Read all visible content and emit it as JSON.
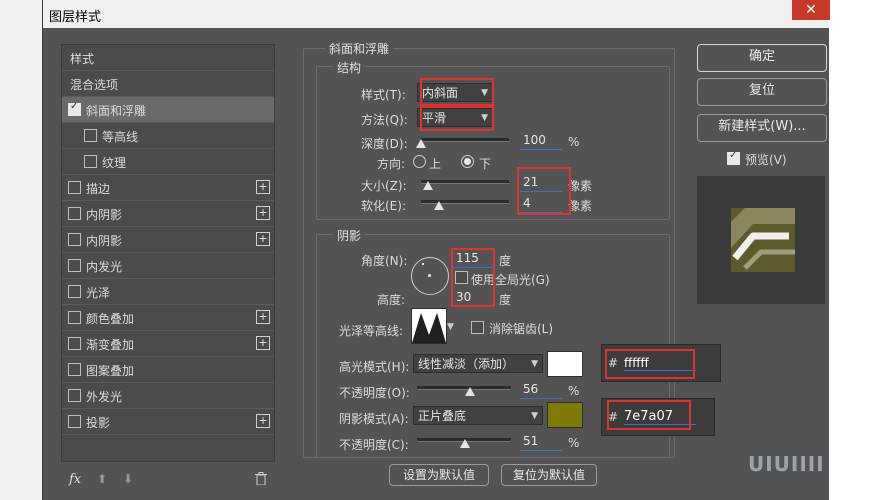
{
  "window": {
    "title": "图层样式",
    "close": "✕"
  },
  "left_panel": {
    "header": "样式",
    "blend": "混合选项",
    "items": [
      {
        "label": "斜面和浮雕",
        "checked": true,
        "plus": false,
        "selected": true
      },
      {
        "label": "等高线",
        "checked": false,
        "plus": false,
        "sub": true
      },
      {
        "label": "纹理",
        "checked": false,
        "plus": false,
        "sub": true
      },
      {
        "label": "描边",
        "checked": false,
        "plus": true
      },
      {
        "label": "内阴影",
        "checked": false,
        "plus": true
      },
      {
        "label": "内阴影",
        "checked": false,
        "plus": true
      },
      {
        "label": "内发光",
        "checked": false,
        "plus": false
      },
      {
        "label": "光泽",
        "checked": false,
        "plus": false
      },
      {
        "label": "颜色叠加",
        "checked": false,
        "plus": true
      },
      {
        "label": "渐变叠加",
        "checked": false,
        "plus": true
      },
      {
        "label": "图案叠加",
        "checked": false,
        "plus": false
      },
      {
        "label": "外发光",
        "checked": false,
        "plus": false
      },
      {
        "label": "投影",
        "checked": false,
        "plus": true
      }
    ],
    "footer": {
      "fx": "fx",
      "up": "⬆",
      "down": "⬇",
      "trash": "🗑"
    }
  },
  "bevel": {
    "title": "斜面和浮雕",
    "structure": {
      "title": "结构",
      "style_label": "样式(T):",
      "style_value": "内斜面",
      "technique_label": "方法(Q):",
      "technique_value": "平滑",
      "depth_label": "深度(D):",
      "depth_value": "100",
      "depth_unit": "%",
      "depth_level": 0.0,
      "direction_label": "方向:",
      "dir_up": "上",
      "dir_down": "下",
      "direction_selected": "下",
      "size_label": "大小(Z):",
      "size_value": "21",
      "size_unit": "像素",
      "size_level": 0.08,
      "soften_label": "软化(E):",
      "soften_value": "4",
      "soften_unit": "像素",
      "soften_level": 0.2
    },
    "shading": {
      "title": "阴影",
      "angle_label": "角度(N):",
      "angle_value": "115",
      "angle_unit": "度",
      "global_light_label": "使用全局光(G)",
      "global_light_checked": false,
      "altitude_label": "高度:",
      "altitude_value": "30",
      "altitude_unit": "度",
      "gloss_label": "光泽等高线:",
      "antialias_label": "消除锯齿(L)",
      "highlight_mode_label": "高光模式(H):",
      "highlight_mode_value": "线性减淡（添加）",
      "highlight_color": "#ffffff",
      "highlight_opacity_label": "不透明度(O):",
      "highlight_opacity_value": "56",
      "highlight_opacity_level": 0.56,
      "shadow_mode_label": "阴影模式(A):",
      "shadow_mode_value": "正片叠底",
      "shadow_color": "#7e7a07",
      "shadow_opacity_label": "不透明度(C):",
      "shadow_opacity_value": "51",
      "shadow_opacity_level": 0.51,
      "percent": "%"
    },
    "set_default": "设置为默认值",
    "reset_default": "复位为默认值"
  },
  "hex_popups": {
    "hash": "#",
    "highlight_hex": "ffffff",
    "shadow_hex": "7e7a07"
  },
  "right_panel": {
    "ok": "确定",
    "reset": "复位",
    "new_style": "新建样式(W)...",
    "preview_label": "预览(V)",
    "preview_checked": true
  },
  "watermark": "UIUIIII"
}
